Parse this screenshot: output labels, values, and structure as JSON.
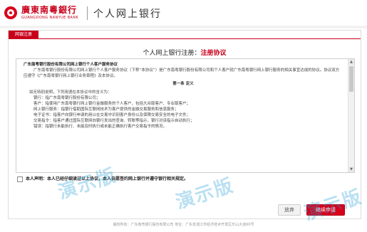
{
  "header": {
    "bank_name_cn": "廣東南粵銀行",
    "bank_name_en": "GUANGDONG NANYUE BANK",
    "title": "个人网上银行",
    "logo_icon": "bank-logo-icon"
  },
  "card": {
    "tab_label": "网银注册",
    "title_prefix": "个人网上银行注册：",
    "title_highlight": "注册协议"
  },
  "agreement": {
    "heading": "广东南粤银行股份有限公司网上银行个人客户服务协议",
    "intro": "广东南粤银行股份有限公司网上银行个人客户服务协议（下称“本协议”）是广东南粤银行股份有限公司和个人客户就广东南粤银行网上银行服务的相关事宜达成的协议。协议双方应遵守《广东南粤银行网上银行业务章程》及本协议。",
    "chapter": "第一条  定义",
    "definitions_intro": "如无特别说明，下列用语在本协议中的含义为：",
    "definitions": [
      "银行：指广东南粤银行股份有限公司；",
      "客户：指使用广东南粤银行网上银行金融服务的个人客户，包括大众版客户、专业版客户；",
      "网上银行服务：指银行借助国际互联网技术为客户提供的金融交易服务和信息服务；",
      "电子证书：指客户向银行申请的用以在交易中识别客户身份以及保障交易安全的电子文件；",
      "交易指令：指客户通过国际互联网向银行发出的查询、转账等指示，银行对该指示自动执行；",
      "错误：指银行未能执行、未能及时执行或未能正确执行客户交易指令的情况。"
    ]
  },
  "declaration": {
    "prefix": "本人声明：",
    "text": "本人已经仔细读过以上协议，本人自愿签约网上银行并遵守银行相关规定。"
  },
  "buttons": {
    "back": "放弃",
    "next": "继续申请"
  },
  "footer": {
    "text": "版权所有：广东南粤银行股份有限公司  地址：广东省湛江市经济技术开发区乐山大道60号"
  },
  "watermark": {
    "text": "演示版"
  },
  "colors": {
    "brand_red": "#c8001a",
    "watermark_blue": "#28a0d7"
  }
}
